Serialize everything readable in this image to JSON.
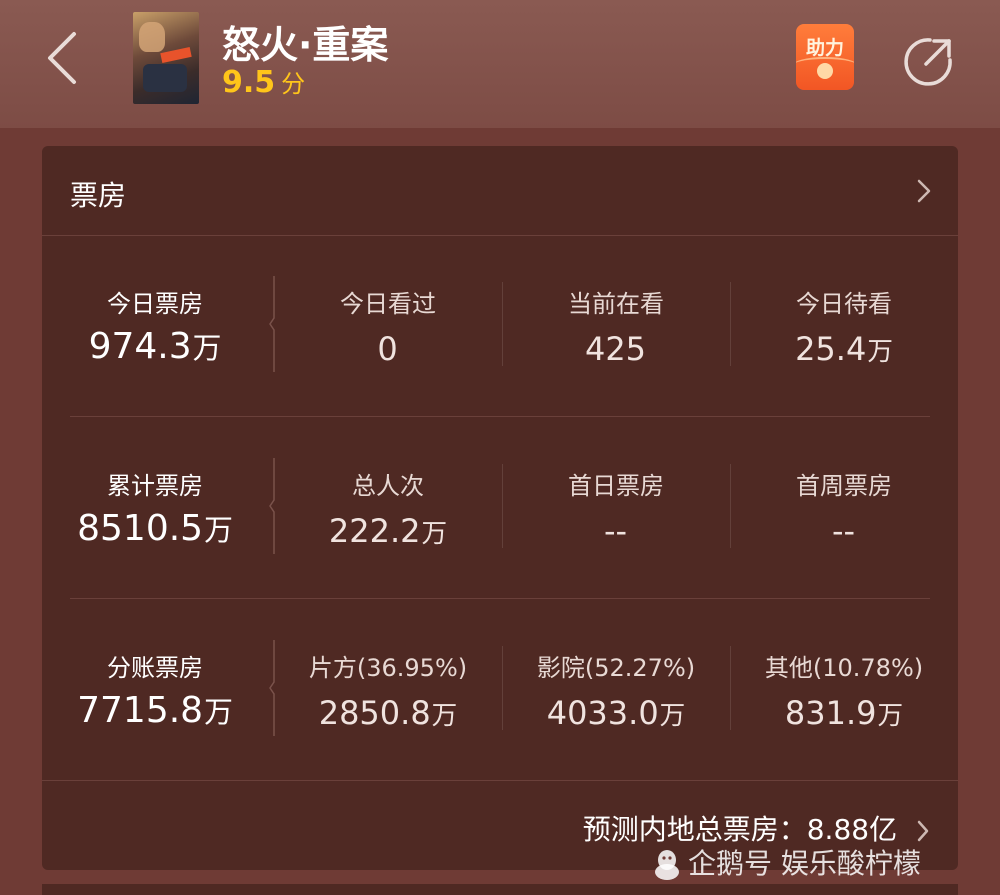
{
  "header": {
    "title": "怒火·重案",
    "rating_value": "9.5",
    "rating_unit": "分",
    "help_label": "助力",
    "icons": {
      "back": "chevron-left-icon",
      "share": "share-icon",
      "help": "red-envelope-icon"
    },
    "colors": {
      "rating": "#ffc51a",
      "help_button": "#f25624"
    }
  },
  "box_office": {
    "title": "票房",
    "rows": [
      [
        {
          "label": "今日票房",
          "value": "974.3",
          "unit": "万"
        },
        {
          "label": "今日看过",
          "value": "0",
          "unit": ""
        },
        {
          "label": "当前在看",
          "value": "425",
          "unit": ""
        },
        {
          "label": "今日待看",
          "value": "25.4",
          "unit": "万"
        }
      ],
      [
        {
          "label": "累计票房",
          "value": "8510.5",
          "unit": "万"
        },
        {
          "label": "总人次",
          "value": "222.2",
          "unit": "万"
        },
        {
          "label": "首日票房",
          "value": "--",
          "unit": ""
        },
        {
          "label": "首周票房",
          "value": "--",
          "unit": ""
        }
      ],
      [
        {
          "label": "分账票房",
          "value": "7715.8",
          "unit": "万"
        },
        {
          "label": "片方(36.95%)",
          "value": "2850.8",
          "unit": "万"
        },
        {
          "label": "影院(52.27%)",
          "value": "4033.0",
          "unit": "万"
        },
        {
          "label": "其他(10.78%)",
          "value": "831.9",
          "unit": "万"
        }
      ]
    ],
    "forecast": "预测内地总票房：8.88亿"
  },
  "watermark": "企鹅号 娱乐酸柠檬"
}
